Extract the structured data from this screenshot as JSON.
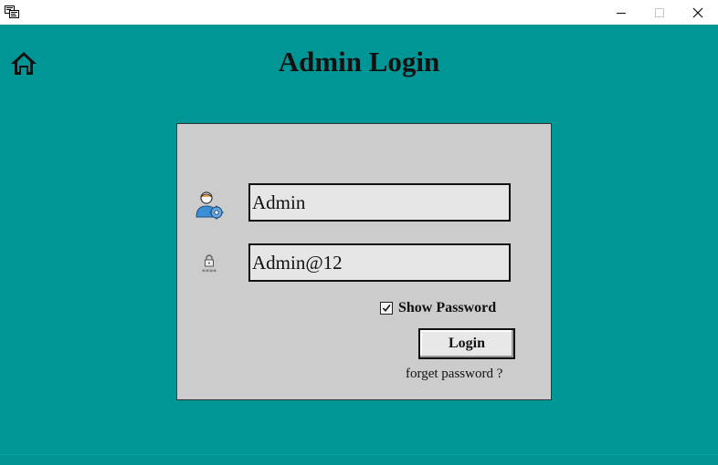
{
  "window": {
    "minimize_icon": "minimize-icon",
    "maximize_icon": "maximize-icon",
    "close_icon": "close-icon"
  },
  "header": {
    "title": "Admin Login",
    "home_icon": "home-icon"
  },
  "form": {
    "username_value": "Admin",
    "password_value": "Admin@12",
    "show_password_label": "Show Password",
    "show_password_checked": true,
    "login_label": "Login",
    "forget_label": "forget password ?"
  },
  "colors": {
    "background": "#009696",
    "panel": "#cccccc",
    "field": "#e6e6e6"
  }
}
